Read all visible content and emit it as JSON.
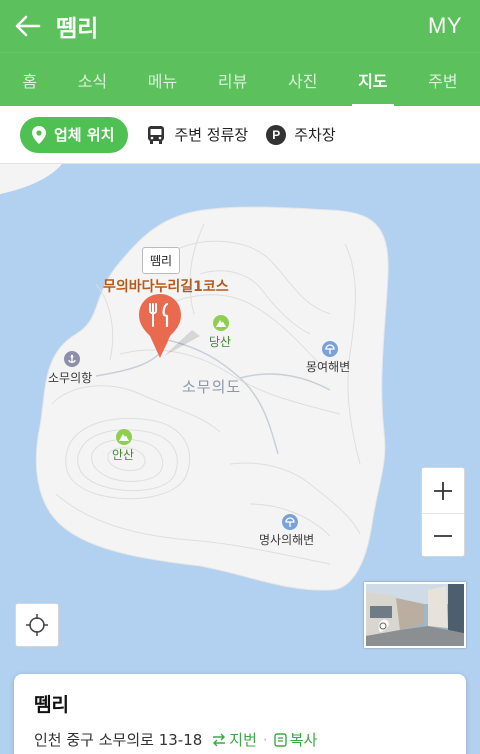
{
  "header": {
    "title": "뗌리",
    "right_label": "MY"
  },
  "tabs": [
    {
      "label": "홈",
      "active": false
    },
    {
      "label": "소식",
      "active": false
    },
    {
      "label": "메뉴",
      "active": false
    },
    {
      "label": "리뷰",
      "active": false
    },
    {
      "label": "사진",
      "active": false
    },
    {
      "label": "지도",
      "active": true
    },
    {
      "label": "주변",
      "active": false
    }
  ],
  "chips": [
    {
      "label": "업체 위치",
      "icon": "location-pin-icon",
      "active": true
    },
    {
      "label": "주변 정류장",
      "icon": "bus-icon",
      "active": false
    },
    {
      "label": "주차장",
      "icon": "parking-icon",
      "badge": "P",
      "active": false
    }
  ],
  "map": {
    "callout": "뗌리",
    "course_label": "무의바다누리길1코스",
    "island_label": "소무의도",
    "places": [
      {
        "label": "당산",
        "type": "mountain"
      },
      {
        "label": "안산",
        "type": "mountain"
      },
      {
        "label": "소무의항",
        "type": "harbor"
      },
      {
        "label": "몽여해변",
        "type": "beach"
      },
      {
        "label": "명사의해변",
        "type": "beach"
      }
    ],
    "colors": {
      "water": "#b2d0ef",
      "land": "#f4f4f4",
      "marker": "#ea6a4f",
      "accent": "#5cc05d"
    }
  },
  "info_card": {
    "name": "뗌리",
    "address": "인천 중구 소무의로 13-18",
    "jibun_label": "지번",
    "copy_label": "복사"
  }
}
